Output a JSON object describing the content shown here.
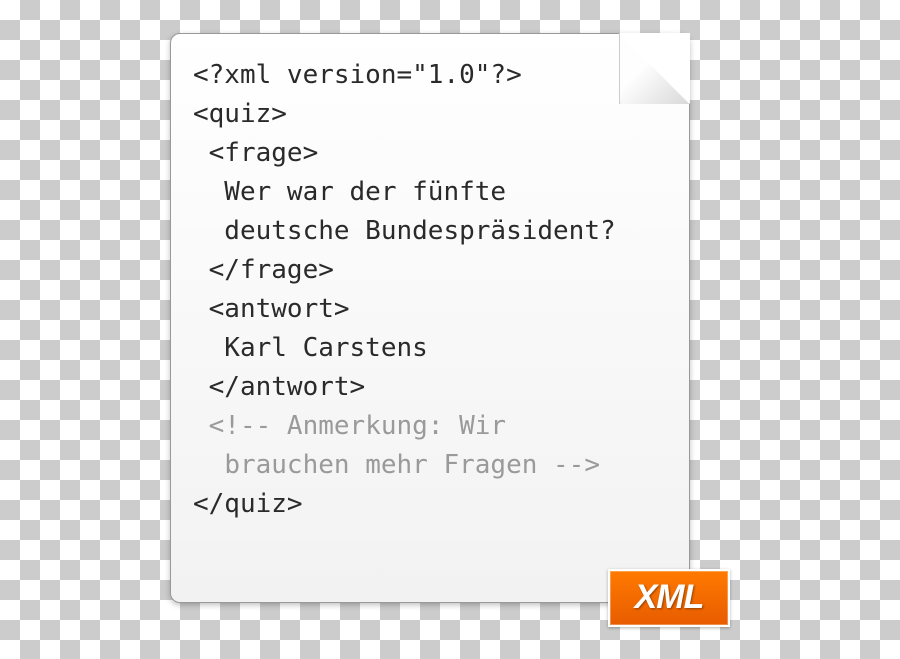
{
  "code": {
    "lines": [
      {
        "text": "<?xml version=\"1.0\"?>",
        "indent": 0,
        "style": "normal"
      },
      {
        "text": "<quiz>",
        "indent": 0,
        "style": "normal"
      },
      {
        "text": "<frage>",
        "indent": 1,
        "style": "normal"
      },
      {
        "text": "Wer war der fünfte",
        "indent": 2,
        "style": "normal"
      },
      {
        "text": "deutsche Bundespräsident?",
        "indent": 2,
        "style": "normal"
      },
      {
        "text": "</frage>",
        "indent": 1,
        "style": "normal"
      },
      {
        "text": "<antwort>",
        "indent": 1,
        "style": "normal"
      },
      {
        "text": "Karl Carstens",
        "indent": 2,
        "style": "normal"
      },
      {
        "text": "</antwort>",
        "indent": 1,
        "style": "normal"
      },
      {
        "text": "<!-- Anmerkung: Wir",
        "indent": 1,
        "style": "comment"
      },
      {
        "text": "brauchen mehr Fragen -->",
        "indent": 2,
        "style": "comment"
      },
      {
        "text": "</quiz>",
        "indent": 0,
        "style": "normal"
      }
    ]
  },
  "badge": {
    "label": "XML"
  }
}
